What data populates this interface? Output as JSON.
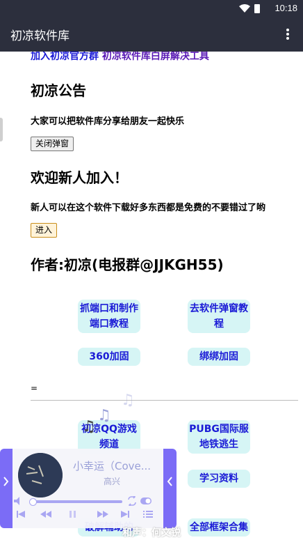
{
  "status": {
    "time": "10:18"
  },
  "appbar": {
    "title": "初凉软件库"
  },
  "top_links": {
    "official_group": "加入初凉官方群",
    "blank_fix": "初凉软件库白屏解决工具"
  },
  "notice": {
    "title": "初凉公告",
    "text": "大家可以把软件库分享给朋友一起快乐",
    "close_button": "关闭弹窗"
  },
  "welcome": {
    "title": "欢迎新人加入！",
    "text": "新人可以在这个软件下载好多东西都是免费的不要错过了哟",
    "enter_button": "进入"
  },
  "author": {
    "title": "作者:初凉(电报群@JJKGH55)"
  },
  "grid": {
    "b1": "抓端口和制作端口教程",
    "b2": "去软件弹窗教程",
    "b3": "360加固",
    "b4": "绑绑加固",
    "b5": "初凉QQ游戏频道",
    "b6": "PUBG国际服地铁逃生",
    "b7": "学习资料",
    "b8": "破解辅助的",
    "b9": "全部框架合集"
  },
  "separator": "=",
  "player": {
    "song": "小幸运（Cove...",
    "artist": "高兴"
  },
  "caption": "和声：何文锐",
  "colors": {
    "appbar": "#2c2f3d",
    "link": "#1a1ad6",
    "pill_bg": "#d6f5f5",
    "player_accent": "#7b6cf6"
  }
}
